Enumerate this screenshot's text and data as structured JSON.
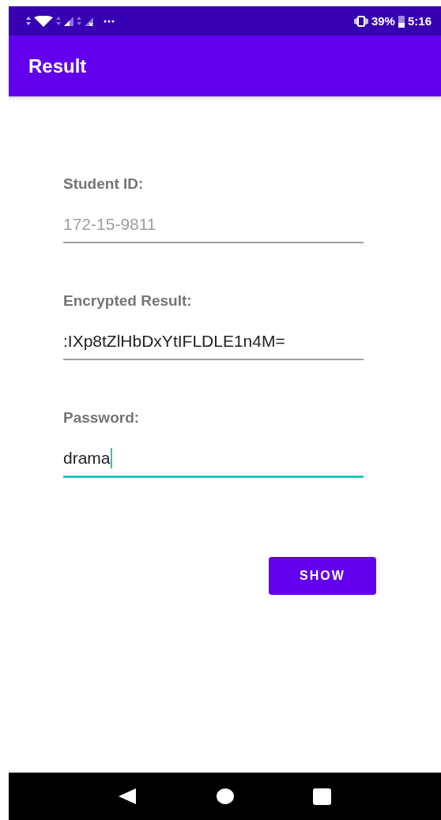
{
  "status_bar": {
    "battery": "39%",
    "time": "5:16"
  },
  "app_bar": {
    "title": "Result"
  },
  "fields": [
    {
      "label": "Student ID:",
      "value": "172-15-9811",
      "disabled": true,
      "focused": false
    },
    {
      "label": "Encrypted Result:",
      "value": ":IXp8tZlHbDxYtIFLDLE1n4M=",
      "disabled": false,
      "focused": false
    },
    {
      "label": "Password:",
      "value": "drama",
      "disabled": false,
      "focused": true
    }
  ],
  "button": {
    "label": "SHOW"
  }
}
